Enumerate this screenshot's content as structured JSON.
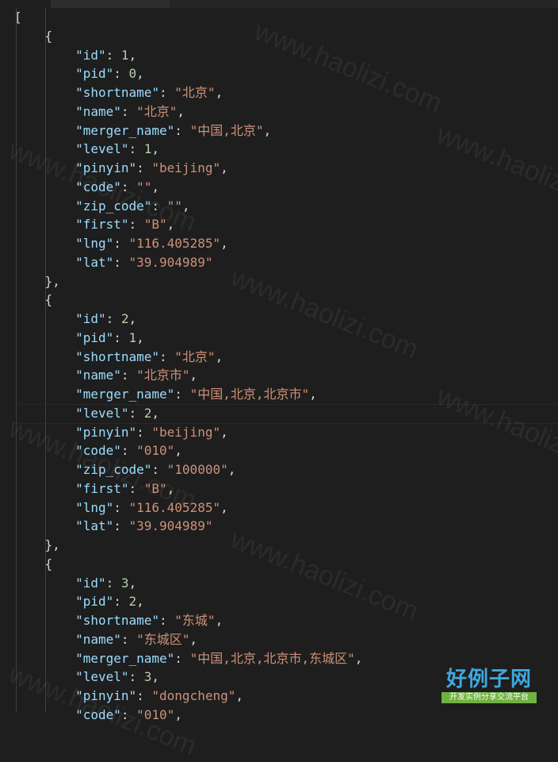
{
  "editor": {
    "lines": [
      [
        [
          "p",
          "["
        ]
      ],
      [
        [
          "p",
          "    {"
        ]
      ],
      [
        [
          "p",
          "        "
        ],
        [
          "k",
          "\"id\""
        ],
        [
          "p",
          ": "
        ],
        [
          "n",
          "1"
        ],
        [
          "p",
          ","
        ]
      ],
      [
        [
          "p",
          "        "
        ],
        [
          "k",
          "\"pid\""
        ],
        [
          "p",
          ": "
        ],
        [
          "n",
          "0"
        ],
        [
          "p",
          ","
        ]
      ],
      [
        [
          "p",
          "        "
        ],
        [
          "k",
          "\"shortname\""
        ],
        [
          "p",
          ": "
        ],
        [
          "s",
          "\"北京\""
        ],
        [
          "p",
          ","
        ]
      ],
      [
        [
          "p",
          "        "
        ],
        [
          "k",
          "\"name\""
        ],
        [
          "p",
          ": "
        ],
        [
          "s",
          "\"北京\""
        ],
        [
          "p",
          ","
        ]
      ],
      [
        [
          "p",
          "        "
        ],
        [
          "k",
          "\"merger_name\""
        ],
        [
          "p",
          ": "
        ],
        [
          "s",
          "\"中国,北京\""
        ],
        [
          "p",
          ","
        ]
      ],
      [
        [
          "p",
          "        "
        ],
        [
          "k",
          "\"level\""
        ],
        [
          "p",
          ": "
        ],
        [
          "n",
          "1"
        ],
        [
          "p",
          ","
        ]
      ],
      [
        [
          "p",
          "        "
        ],
        [
          "k",
          "\"pinyin\""
        ],
        [
          "p",
          ": "
        ],
        [
          "s",
          "\"beijing\""
        ],
        [
          "p",
          ","
        ]
      ],
      [
        [
          "p",
          "        "
        ],
        [
          "k",
          "\"code\""
        ],
        [
          "p",
          ": "
        ],
        [
          "s",
          "\"\""
        ],
        [
          "p",
          ","
        ]
      ],
      [
        [
          "p",
          "        "
        ],
        [
          "k",
          "\"zip_code\""
        ],
        [
          "p",
          ": "
        ],
        [
          "s",
          "\"\""
        ],
        [
          "p",
          ","
        ]
      ],
      [
        [
          "p",
          "        "
        ],
        [
          "k",
          "\"first\""
        ],
        [
          "p",
          ": "
        ],
        [
          "s",
          "\"B\""
        ],
        [
          "p",
          ","
        ]
      ],
      [
        [
          "p",
          "        "
        ],
        [
          "k",
          "\"lng\""
        ],
        [
          "p",
          ": "
        ],
        [
          "s",
          "\"116.405285\""
        ],
        [
          "p",
          ","
        ]
      ],
      [
        [
          "p",
          "        "
        ],
        [
          "k",
          "\"lat\""
        ],
        [
          "p",
          ": "
        ],
        [
          "s",
          "\"39.904989\""
        ]
      ],
      [
        [
          "p",
          "    },"
        ]
      ],
      [
        [
          "p",
          "    {"
        ]
      ],
      [
        [
          "p",
          "        "
        ],
        [
          "k",
          "\"id\""
        ],
        [
          "p",
          ": "
        ],
        [
          "n",
          "2"
        ],
        [
          "p",
          ","
        ]
      ],
      [
        [
          "p",
          "        "
        ],
        [
          "k",
          "\"pid\""
        ],
        [
          "p",
          ": "
        ],
        [
          "n",
          "1"
        ],
        [
          "p",
          ","
        ]
      ],
      [
        [
          "p",
          "        "
        ],
        [
          "k",
          "\"shortname\""
        ],
        [
          "p",
          ": "
        ],
        [
          "s",
          "\"北京\""
        ],
        [
          "p",
          ","
        ]
      ],
      [
        [
          "p",
          "        "
        ],
        [
          "k",
          "\"name\""
        ],
        [
          "p",
          ": "
        ],
        [
          "s",
          "\"北京市\""
        ],
        [
          "p",
          ","
        ]
      ],
      [
        [
          "p",
          "        "
        ],
        [
          "k",
          "\"merger_name\""
        ],
        [
          "p",
          ": "
        ],
        [
          "s",
          "\"中国,北京,北京市\""
        ],
        [
          "p",
          ","
        ]
      ],
      [
        [
          "p",
          "        "
        ],
        [
          "k",
          "\"level\""
        ],
        [
          "p",
          ": "
        ],
        [
          "n",
          "2"
        ],
        [
          "p",
          ","
        ]
      ],
      [
        [
          "p",
          "        "
        ],
        [
          "k",
          "\"pinyin\""
        ],
        [
          "p",
          ": "
        ],
        [
          "s",
          "\"beijing\""
        ],
        [
          "p",
          ","
        ]
      ],
      [
        [
          "p",
          "        "
        ],
        [
          "k",
          "\"code\""
        ],
        [
          "p",
          ": "
        ],
        [
          "s",
          "\"010\""
        ],
        [
          "p",
          ","
        ]
      ],
      [
        [
          "p",
          "        "
        ],
        [
          "k",
          "\"zip_code\""
        ],
        [
          "p",
          ": "
        ],
        [
          "s",
          "\"100000\""
        ],
        [
          "p",
          ","
        ]
      ],
      [
        [
          "p",
          "        "
        ],
        [
          "k",
          "\"first\""
        ],
        [
          "p",
          ": "
        ],
        [
          "s",
          "\"B\""
        ],
        [
          "p",
          ","
        ]
      ],
      [
        [
          "p",
          "        "
        ],
        [
          "k",
          "\"lng\""
        ],
        [
          "p",
          ": "
        ],
        [
          "s",
          "\"116.405285\""
        ],
        [
          "p",
          ","
        ]
      ],
      [
        [
          "p",
          "        "
        ],
        [
          "k",
          "\"lat\""
        ],
        [
          "p",
          ": "
        ],
        [
          "s",
          "\"39.904989\""
        ]
      ],
      [
        [
          "p",
          "    },"
        ]
      ],
      [
        [
          "p",
          "    {"
        ]
      ],
      [
        [
          "p",
          "        "
        ],
        [
          "k",
          "\"id\""
        ],
        [
          "p",
          ": "
        ],
        [
          "n",
          "3"
        ],
        [
          "p",
          ","
        ]
      ],
      [
        [
          "p",
          "        "
        ],
        [
          "k",
          "\"pid\""
        ],
        [
          "p",
          ": "
        ],
        [
          "n",
          "2"
        ],
        [
          "p",
          ","
        ]
      ],
      [
        [
          "p",
          "        "
        ],
        [
          "k",
          "\"shortname\""
        ],
        [
          "p",
          ": "
        ],
        [
          "s",
          "\"东城\""
        ],
        [
          "p",
          ","
        ]
      ],
      [
        [
          "p",
          "        "
        ],
        [
          "k",
          "\"name\""
        ],
        [
          "p",
          ": "
        ],
        [
          "s",
          "\"东城区\""
        ],
        [
          "p",
          ","
        ]
      ],
      [
        [
          "p",
          "        "
        ],
        [
          "k",
          "\"merger_name\""
        ],
        [
          "p",
          ": "
        ],
        [
          "s",
          "\"中国,北京,北京市,东城区\""
        ],
        [
          "p",
          ","
        ]
      ],
      [
        [
          "p",
          "        "
        ],
        [
          "k",
          "\"level\""
        ],
        [
          "p",
          ": "
        ],
        [
          "n",
          "3"
        ],
        [
          "p",
          ","
        ]
      ],
      [
        [
          "p",
          "        "
        ],
        [
          "k",
          "\"pinyin\""
        ],
        [
          "p",
          ": "
        ],
        [
          "s",
          "\"dongcheng\""
        ],
        [
          "p",
          ","
        ]
      ],
      [
        [
          "p",
          "        "
        ],
        [
          "k",
          "\"code\""
        ],
        [
          "p",
          ": "
        ],
        [
          "s",
          "\"010\""
        ],
        [
          "p",
          ","
        ]
      ]
    ]
  },
  "watermark": {
    "text": "www.haolizi.com"
  },
  "logo": {
    "main": "好例子网",
    "sub": "开发实例分享交流平台"
  },
  "colors": {
    "background": "#1e1e1e",
    "key": "#9cdcfe",
    "string": "#ce9178",
    "number": "#b5cea8",
    "punctuation": "#d4d4d4",
    "logo_blue": "#3ea8e0",
    "logo_green": "#6fb240"
  }
}
